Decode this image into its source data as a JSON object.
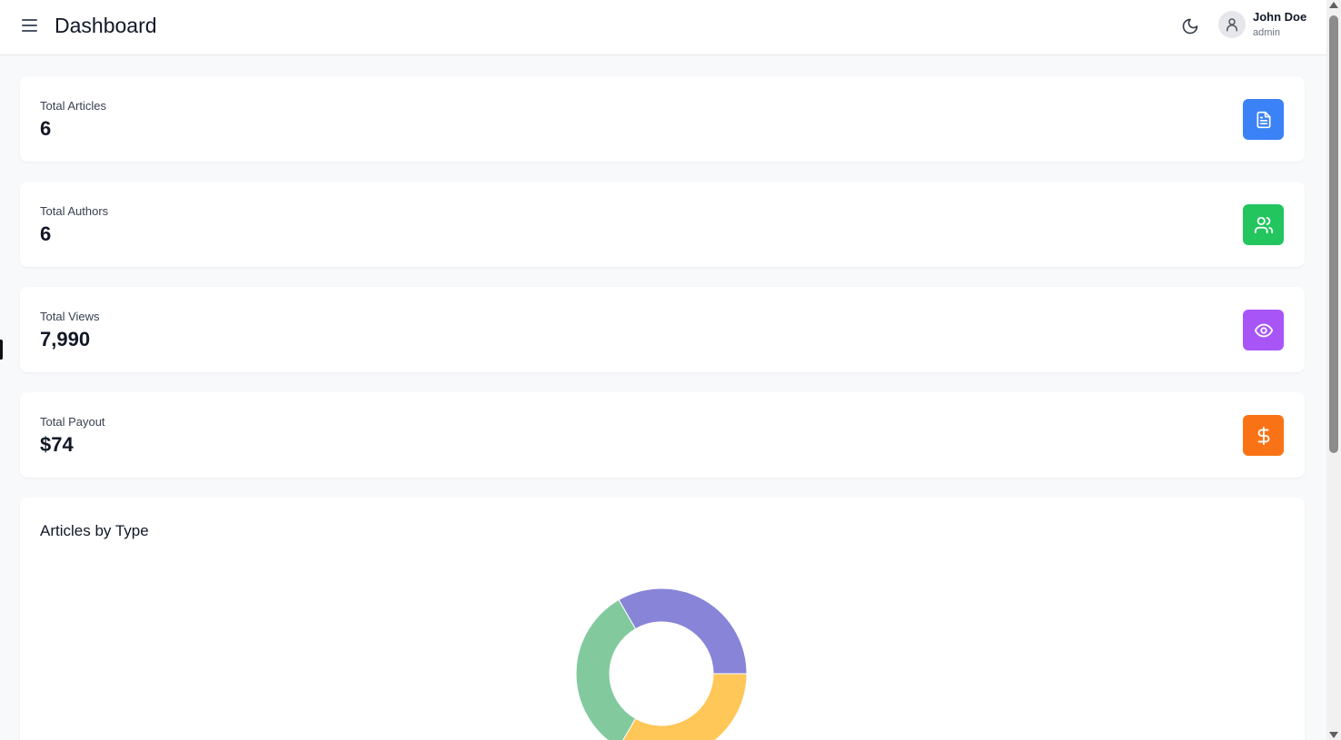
{
  "header": {
    "title": "Dashboard",
    "menu_icon": "hamburger-menu-icon",
    "theme_icon": "moon-icon",
    "user": {
      "name": "John Doe",
      "role": "admin",
      "avatar_icon": "user-icon"
    }
  },
  "stats": [
    {
      "label": "Total Articles",
      "value": "6",
      "icon": "document-icon",
      "color": "#3b82f6"
    },
    {
      "label": "Total Authors",
      "value": "6",
      "icon": "users-icon",
      "color": "#22c55e"
    },
    {
      "label": "Total Views",
      "value": "7,990",
      "icon": "eye-icon",
      "color": "#a855f7"
    },
    {
      "label": "Total Payout",
      "value": "$74",
      "icon": "dollar-icon",
      "color": "#f97316"
    }
  ],
  "chart_section": {
    "title": "Articles by Type"
  },
  "chart_data": {
    "type": "pie",
    "variant": "donut",
    "categories": [
      "",
      "",
      ""
    ],
    "values": [
      2,
      2,
      2
    ],
    "colors": [
      "#8884d8",
      "#ffc658",
      "#82ca9d"
    ]
  }
}
